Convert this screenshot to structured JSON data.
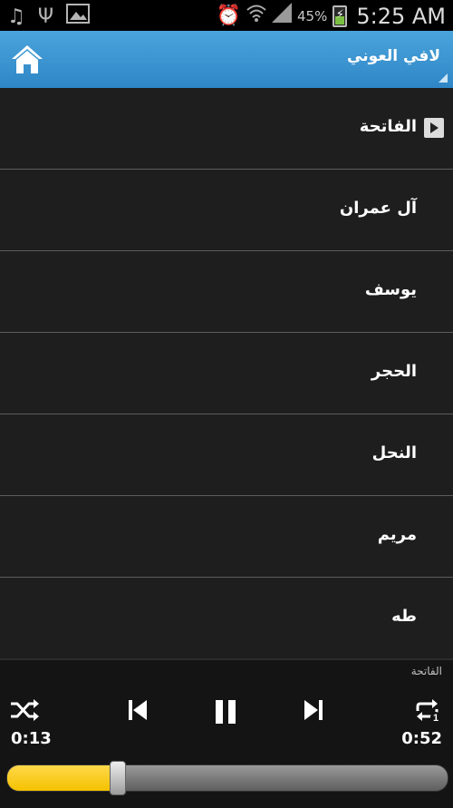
{
  "status_bar": {
    "battery_percent": "45%",
    "battery_level": 0.45,
    "time": "5:25 AM"
  },
  "action_bar": {
    "title": "لافي العوني"
  },
  "surahs": [
    {
      "name": "الفاتحة",
      "playing": true
    },
    {
      "name": "آل عمران",
      "playing": false
    },
    {
      "name": "يوسف",
      "playing": false
    },
    {
      "name": "الحجر",
      "playing": false
    },
    {
      "name": "النحل",
      "playing": false
    },
    {
      "name": "مريم",
      "playing": false
    },
    {
      "name": "طه",
      "playing": false
    }
  ],
  "player": {
    "now_playing": "الفاتحة",
    "elapsed": "0:13",
    "duration": "0:52",
    "progress": 0.25,
    "accent_color": "#f5c200"
  }
}
